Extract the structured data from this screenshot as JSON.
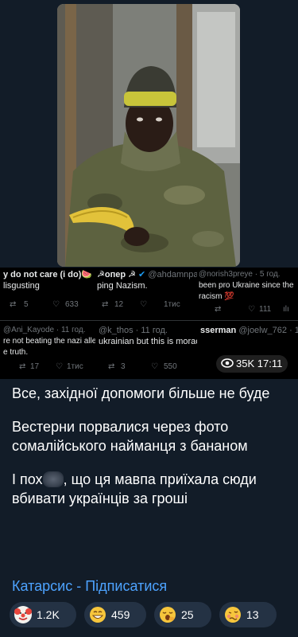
{
  "tweets": [
    {
      "head": "y do not care (i do)🍉",
      "handle": "",
      "text": "lisgusting",
      "retweets": "5",
      "likes": "633",
      "views": ""
    },
    {
      "head": "☭опер ☭",
      "handle": "@ahdamnpa",
      "text": "ping Nazism.",
      "retweets": "12",
      "likes": "",
      "views": "1тис"
    },
    {
      "head": "",
      "handle": "@norish3preye · 5 год.",
      "text": "been pro Ukraine since the",
      "text2": "racism 💯",
      "retweets": "",
      "likes": "",
      "views": "111"
    },
    {
      "head": "",
      "handle": "@Ani_Kayode · 11 год.",
      "text": "re not beating the nazi allega",
      "text2": "e truth.",
      "retweets": "17",
      "likes": "",
      "views": "1тис"
    },
    {
      "head": "",
      "handle": "@k_thos · 11 год.",
      "text": "ukrainian but this is moracist. Glorifying it is disg",
      "retweets": "3",
      "likes": "550",
      "views": ""
    },
    {
      "head": "sserman",
      "handle": "@joelw_762 · 1",
      "text": "",
      "retweets": "",
      "likes": "",
      "views": ""
    }
  ],
  "media_views": "35K",
  "media_time": "17:11",
  "message": {
    "p1": "Все, західної допомоги більше не буде",
    "p2": "Вестерни порвалися через фото сомалійського найманця з бананом",
    "p3_start": "І пох",
    "p3_end": ", що ця мавпа приїхала сюди вбивати українців за гроші"
  },
  "channel_link": "Катарсис - Підписатися",
  "reactions": [
    {
      "icon": "clown-face-icon",
      "count": "1.2K"
    },
    {
      "icon": "grinning-face-icon",
      "count": "459"
    },
    {
      "icon": "yawning-face-icon",
      "count": "25"
    },
    {
      "icon": "woozy-face-icon",
      "count": "13"
    }
  ]
}
